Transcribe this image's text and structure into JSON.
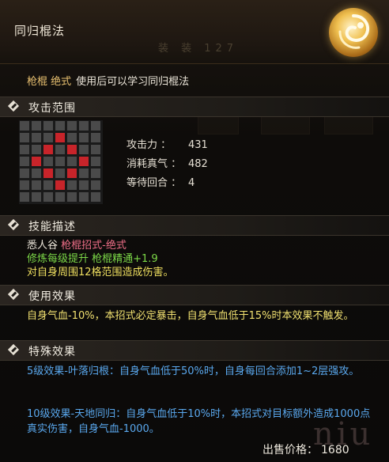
{
  "header": {
    "title": "同归棍法",
    "ghost_text": "装 装 127"
  },
  "subtitle": {
    "tag": "枪棍 绝式",
    "text": "使用后可以学习同归棍法"
  },
  "sections": {
    "range": "攻击范围",
    "desc": "技能描述",
    "use": "使用效果",
    "special": "特殊效果"
  },
  "range_grid": {
    "size": 7,
    "red_cells": [
      [
        1,
        3
      ],
      [
        2,
        2
      ],
      [
        2,
        4
      ],
      [
        3,
        1
      ],
      [
        3,
        5
      ],
      [
        4,
        2
      ],
      [
        4,
        4
      ],
      [
        5,
        3
      ]
    ]
  },
  "stats": [
    {
      "label": "攻击力 ：",
      "value": "431"
    },
    {
      "label": "消耗真气 ：",
      "value": "482"
    },
    {
      "label": "等待回合 ：",
      "value": "4"
    }
  ],
  "description": {
    "line1_prefix": "悉人谷 ",
    "line1_highlight": "枪棍招式-绝式",
    "line2": "修炼每级提升 枪棍精通+1.9",
    "line3": "对自身周围12格范围造成伤害。"
  },
  "use_effect": "自身气血-10%，本招式必定暴击，自身气血低于15%时本效果不触发。",
  "special_effects": [
    "5级效果-叶落归根：自身气血低于50%时，自身每回合添加1~2层强攻。",
    "10级效果-天地同归：自身气血低于10%时，本招式对目标额外造成1000点真实伤害，自身气血-1000。"
  ],
  "price": {
    "label": "出售价格：",
    "value": "1680"
  },
  "watermark": "niu",
  "icons": {
    "emblem": "swirl-emblem-icon",
    "section_marker": "diamond-icon"
  },
  "colors": {
    "red_cell": "#c8242a",
    "highlight_pink": "#ef6f88",
    "green": "#7cd848",
    "yellow": "#f0e070",
    "blue": "#5aa8ee"
  }
}
